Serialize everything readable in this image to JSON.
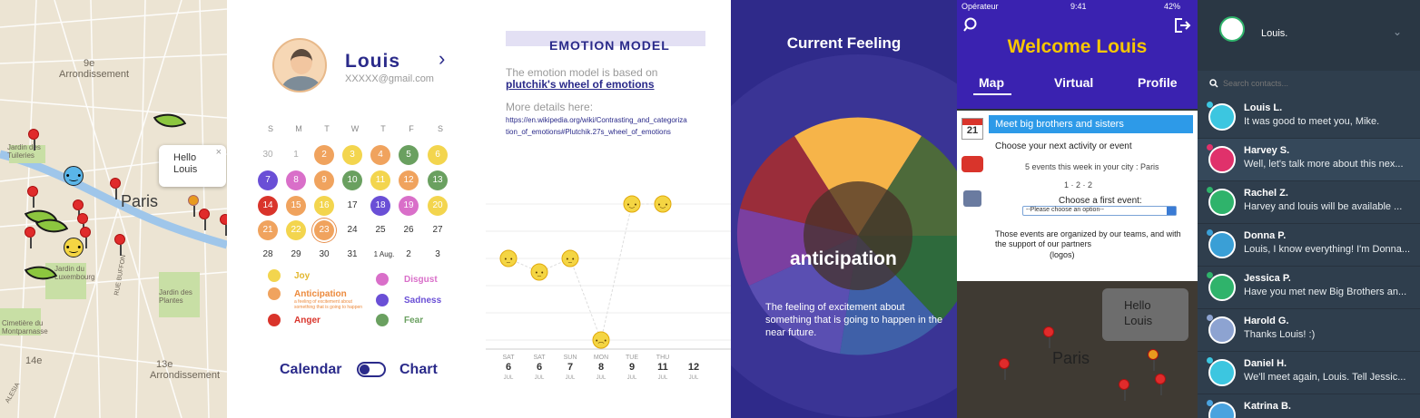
{
  "map": {
    "arrondissement_9": "9e",
    "arrondissement_label": "Arrondissement",
    "arrondissement_14": "14e",
    "arrondissement_13": "13e",
    "city": "Paris",
    "jardin_tuileries": "Jardin des Tuileries",
    "jardin_luxembourg": "Jardin du Luxembourg",
    "jardin_plantes": "Jardin des Plantes",
    "cimetiere": "Cimetière du Montparnasse",
    "rue_buffon": "RUE BUFFON",
    "bd_hopital": "BOULEVARD DE L'HÔPITAL",
    "alesia": "ALESIA",
    "popup_text": "Hello Louis",
    "close": "×"
  },
  "profile": {
    "name": "Louis",
    "email": "XXXXX@gmail.com",
    "chevron": "›",
    "days": [
      "S",
      "M",
      "T",
      "W",
      "T",
      "F",
      "S"
    ],
    "calendar": [
      [
        "30",
        "1",
        "2",
        "3",
        "4",
        "5",
        "6"
      ],
      [
        "7",
        "8",
        "9",
        "10",
        "11",
        "12",
        "13"
      ],
      [
        "14",
        "15",
        "16",
        "17",
        "18",
        "19",
        "20"
      ],
      [
        "21",
        "22",
        "23",
        "24",
        "25",
        "26",
        "27"
      ],
      [
        "28",
        "29",
        "30",
        "31",
        "1 Aug.",
        "2",
        "3"
      ]
    ],
    "legend": {
      "joy": "Joy",
      "anticipation": "Anticipation",
      "anticipation_desc": "a feeling of excitement about something that is going to happen",
      "anger": "Anger",
      "disgust": "Disgust",
      "sadness": "Sadness",
      "fear": "Fear"
    },
    "toggle_left": "Calendar",
    "toggle_right": "Chart",
    "colors": {
      "joy": "#f3d54e",
      "anticipation": "#f0a35e",
      "anger": "#d9342b",
      "disgust": "#d96fc9",
      "sadness": "#6a4fd6",
      "fear": "#6aa060"
    }
  },
  "emotion_model": {
    "title": "EMOTION MODEL",
    "intro": "The emotion model is based on",
    "link": "plutchik's wheel of emotions",
    "more": "More details here:",
    "url": "https://en.wikipedia.org/wiki/Contrasting_and_categorization_of_emotions#Plutchik.27s_wheel_of_emotions"
  },
  "chart_data": {
    "type": "line",
    "categories": [
      {
        "day": "SAT",
        "num": "6",
        "mon": "JUL"
      },
      {
        "day": "SAT",
        "num": "6",
        "mon": "JUL"
      },
      {
        "day": "SUN",
        "num": "7",
        "mon": "JUL"
      },
      {
        "day": "MON",
        "num": "8",
        "mon": "JUL"
      },
      {
        "day": "TUE",
        "num": "9",
        "mon": "JUL"
      },
      {
        "day": "THU",
        "num": "11",
        "mon": "JUL"
      },
      {
        "day": "",
        "num": "12",
        "mon": "JUL"
      }
    ],
    "values": [
      3,
      2.5,
      3,
      0,
      5,
      5
    ],
    "markers": [
      "neutral",
      "neutral",
      "neutral",
      "sad",
      "happy",
      "happy"
    ]
  },
  "feeling": {
    "title": "Current Feeling",
    "emotion": "anticipation",
    "description": "The feeling of excitement about something that is going to happen in the near future."
  },
  "phone": {
    "carrier": "Opérateur",
    "time": "9:41",
    "battery": "42%",
    "welcome": "Welcome Louis",
    "tabs": [
      "Map",
      "Virtual",
      "Profile"
    ],
    "card_title": "Meet big brothers and sisters",
    "activity": "Choose your next activity or event",
    "events_count": "5 events this week in your city : Paris",
    "counts": "1 · 2 · 2",
    "choose_first": "Choose a first event:",
    "select_placeholder": "--Please choose an option--",
    "organized": "Those events are organized by our teams, and with the support of our partners",
    "logos": "(logos)",
    "calendar_day": "21",
    "popup": "Hello Louis",
    "city": "Paris"
  },
  "contacts": {
    "user": "Louis.",
    "search_placeholder": "Search contacts...",
    "items": [
      {
        "name": "Louis L.",
        "msg": "It was good to meet you, Mike.",
        "color": "#3cc6e0"
      },
      {
        "name": "Harvey S.",
        "msg": "Well, let's talk more about this nex...",
        "color": "#e0316b"
      },
      {
        "name": "Rachel Z.",
        "msg": "Harvey and louis will be available ...",
        "color": "#2fb36b"
      },
      {
        "name": "Donna P.",
        "msg": "Louis, I know everything! I'm Donna...",
        "color": "#3a9fd6"
      },
      {
        "name": "Jessica P.",
        "msg": "Have you met new Big Brothers an...",
        "color": "#2fb36b"
      },
      {
        "name": "Harold G.",
        "msg": "Thanks Louis! :)",
        "color": "#8da3d1"
      },
      {
        "name": "Daniel H.",
        "msg": "We'll meet again, Louis. Tell Jessic...",
        "color": "#3cc6e0"
      },
      {
        "name": "Katrina B.",
        "msg": "",
        "color": "#4aa3df"
      }
    ]
  }
}
